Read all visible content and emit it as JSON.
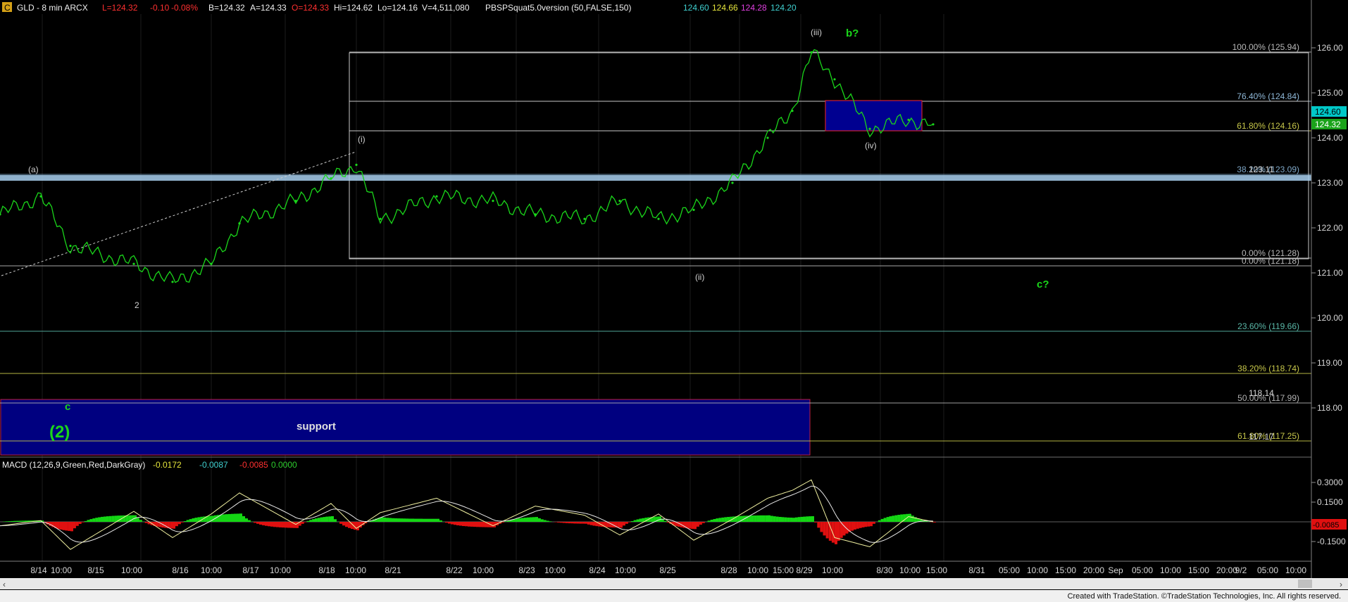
{
  "header": {
    "symbol_badge": "C",
    "title": "GLD - 8 min  ARCX",
    "last": "L=124.32",
    "change": "-0.10",
    "change_pct": "-0.08%",
    "bid": "B=124.32",
    "ask": "A=124.33",
    "open": "O=124.33",
    "hi": "Hi=124.62",
    "lo": "Lo=124.16",
    "volume": "V=4,511,080",
    "indicator": "PBSPSquat5.0version (50,FALSE,150)",
    "ind_values": [
      {
        "text": "124.60",
        "color": "#3fd0d0"
      },
      {
        "text": "124.66",
        "color": "#e6e63c"
      },
      {
        "text": "124.28",
        "color": "#e040e0"
      },
      {
        "text": "124.20",
        "color": "#3fd0d0"
      }
    ]
  },
  "macd_header": {
    "title": "MACD (12,26,9,Green,Red,DarkGray)",
    "values": [
      {
        "text": "-0.0172",
        "color": "#e6e63c"
      },
      {
        "text": "-0.0087",
        "color": "#3fd0d0"
      },
      {
        "text": "-0.0085",
        "color": "#ff3030"
      },
      {
        "text": "0.0000",
        "color": "#2ecc2e"
      }
    ]
  },
  "price_axis_ticks": [
    "126.00",
    "125.00",
    "124.00",
    "123.00",
    "122.00",
    "121.00",
    "120.00",
    "119.00",
    "118.00"
  ],
  "price_tags": [
    {
      "text": "124.60",
      "color": "#00c8c8"
    },
    {
      "text": "124.32",
      "color": "#1aa31a"
    }
  ],
  "macd_axis_ticks": [
    "0.3000",
    "0.1500",
    "-0.1500"
  ],
  "macd_tag": "-0.0085",
  "time_labels": [
    "8/14",
    "10:00",
    "8/15",
    "10:00",
    "8/16",
    "10:00",
    "8/17",
    "10:00",
    "8/18",
    "10:00",
    "8/21",
    "8/22",
    "10:00",
    "8/23",
    "10:00",
    "8/24",
    "10:00",
    "8/25",
    "8/28",
    "10:00",
    "15:00",
    "8/29",
    "10:00",
    "8/30",
    "10:00",
    "15:00",
    "8/31",
    "05:00",
    "10:00",
    "15:00",
    "20:00",
    "Sep",
    "05:00",
    "10:00",
    "15:00",
    "20:00",
    "9/2",
    "05:00",
    "10:00"
  ],
  "fib_levels": [
    {
      "label": "100.00% (125.94)",
      "color": "#b8b8b8"
    },
    {
      "label": "76.40% (124.84)",
      "color": "#8fb8d8"
    },
    {
      "label": "61.80% (124.16)",
      "color": "#c8c84a"
    },
    {
      "label": "38.20% (123.09)",
      "color": "#7fa8c8"
    },
    {
      "label": "0.00% (121.28)",
      "color": "#b8b8b8"
    },
    {
      "label": "0.00% (121.18)",
      "color": "#b8b8b8"
    },
    {
      "label": "23.60% (119.66)",
      "color": "#5ab8a8"
    },
    {
      "label": "38.20% (118.74)",
      "color": "#c8c84a"
    },
    {
      "label": "50.00% (117.99)",
      "color": "#b0b0b0"
    },
    {
      "label": "61.80% (117.25)",
      "color": "#c8c84a"
    }
  ],
  "level_labels": [
    "123.11",
    "118.14",
    "117.17"
  ],
  "wave_labels": [
    "(a)",
    "2",
    "(i)",
    "(ii)",
    "(iii)",
    "(iv)"
  ],
  "green_labels": [
    "b?",
    "c?",
    "c",
    "(2)"
  ],
  "zone_label": "support",
  "colors": {
    "price_up": "#1ad61a",
    "support_zone": "#000080",
    "macd_hist_pos": "#14d614",
    "macd_hist_neg": "#e01010",
    "macd_line": "#f0f0a0",
    "macd_signal": "#e8e8e8"
  },
  "chart_data": {
    "type": "line",
    "title": "GLD - 8 min  ARCX",
    "xlabel": "",
    "ylabel": "",
    "ylim": [
      117.0,
      126.3
    ],
    "x": [
      "8/14",
      "8/14 10:00",
      "8/15",
      "8/15 10:00",
      "8/16",
      "8/16 10:00",
      "8/17",
      "8/17 10:00",
      "8/18",
      "8/18 10:00",
      "8/21",
      "8/22",
      "8/22 10:00",
      "8/23",
      "8/23 10:00",
      "8/24",
      "8/24 10:00",
      "8/25",
      "8/28",
      "8/28 10:00",
      "8/28 15:00",
      "8/29",
      "8/29 10:00",
      "8/30",
      "8/30 10:00",
      "8/30 15:00"
    ],
    "series": [
      {
        "values": [
          122.3,
          122.7,
          121.6,
          121.2,
          120.8,
          121.2,
          122.1,
          122.6,
          123.1,
          123.4,
          122.2,
          122.7,
          122.6,
          122.3,
          122.2,
          122.6,
          122.2,
          122.4,
          123.0,
          124.0,
          124.6,
          125.9,
          125.3,
          124.2,
          124.4,
          124.3
        ]
      }
    ],
    "macd": [
      -0.03,
      0.01,
      -0.21,
      0.08,
      -0.12,
      0.06,
      0.22,
      -0.02,
      0.14,
      -0.05,
      0.07,
      0.18,
      -0.03,
      0.12,
      0.05,
      -0.1,
      0.06,
      -0.14,
      0.02,
      0.18,
      0.24,
      0.32,
      -0.12,
      -0.19,
      0.04,
      0.0
    ]
  }
}
